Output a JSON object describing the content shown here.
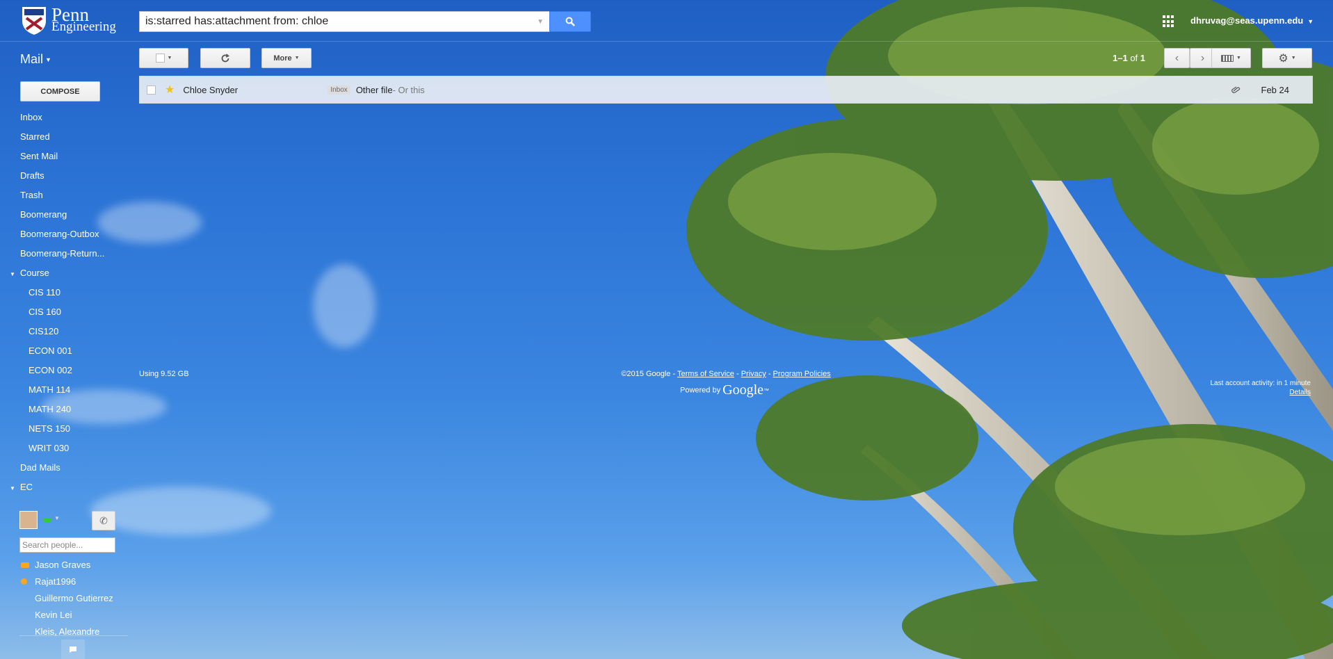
{
  "brand": {
    "line1": "Penn",
    "line2": "Engineering"
  },
  "search": {
    "query": "is:starred has:attachment from: chloe"
  },
  "account": {
    "email": "dhruvag@seas.upenn.edu"
  },
  "toolbar": {
    "mail_label": "Mail",
    "more_label": "More",
    "pager": {
      "range": "1–1",
      "of": "of",
      "total": "1"
    }
  },
  "sidebar": {
    "compose_label": "COMPOSE",
    "items": [
      {
        "label": "Inbox",
        "type": "item"
      },
      {
        "label": "Starred",
        "type": "item"
      },
      {
        "label": "Sent Mail",
        "type": "item"
      },
      {
        "label": "Drafts",
        "type": "item"
      },
      {
        "label": "Trash",
        "type": "item"
      },
      {
        "label": "Boomerang",
        "type": "item"
      },
      {
        "label": "Boomerang-Outbox",
        "type": "item"
      },
      {
        "label": "Boomerang-Return...",
        "type": "item"
      },
      {
        "label": "Course",
        "type": "group"
      },
      {
        "label": "CIS 110",
        "type": "sub"
      },
      {
        "label": "CIS 160",
        "type": "sub"
      },
      {
        "label": "CIS120",
        "type": "sub"
      },
      {
        "label": "ECON 001",
        "type": "sub"
      },
      {
        "label": "ECON 002",
        "type": "sub"
      },
      {
        "label": "MATH 114",
        "type": "sub"
      },
      {
        "label": "MATH 240",
        "type": "sub"
      },
      {
        "label": "NETS 150",
        "type": "sub"
      },
      {
        "label": "WRIT 030",
        "type": "sub"
      },
      {
        "label": "Dad Mails",
        "type": "item"
      },
      {
        "label": "EC",
        "type": "group"
      }
    ]
  },
  "chat": {
    "search_placeholder": "Search people...",
    "contacts": [
      {
        "name": "Jason Graves",
        "status_color": "#f5a623"
      },
      {
        "name": "Rajat1996",
        "status_color": "#f5a623"
      },
      {
        "name": "Guillermo Gutierrez",
        "status_color": ""
      },
      {
        "name": "Kevin Lei",
        "status_color": ""
      },
      {
        "name": "Kleis, Alexandre",
        "status_color": ""
      }
    ]
  },
  "messages": [
    {
      "sender": "Chloe Snyder",
      "label": "Inbox",
      "subject": "Other file",
      "snippet": " - Or this",
      "date": "Feb 24",
      "starred": true,
      "has_attachment": true
    }
  ],
  "footer": {
    "storage": "Using 9.52 GB",
    "copyright": "©2015 Google - ",
    "terms": "Terms of Service",
    "sep1": " - ",
    "privacy": "Privacy",
    "sep2": " - ",
    "policies": "Program Policies",
    "powered_by": "Powered by ",
    "google": "Google",
    "tm": "™",
    "activity": "Last account activity: in 1 minute",
    "details": "Details"
  },
  "colors": {
    "accent_blue": "#4d90fe",
    "star": "#f4c20d",
    "row_bg": "#e8eef4"
  }
}
